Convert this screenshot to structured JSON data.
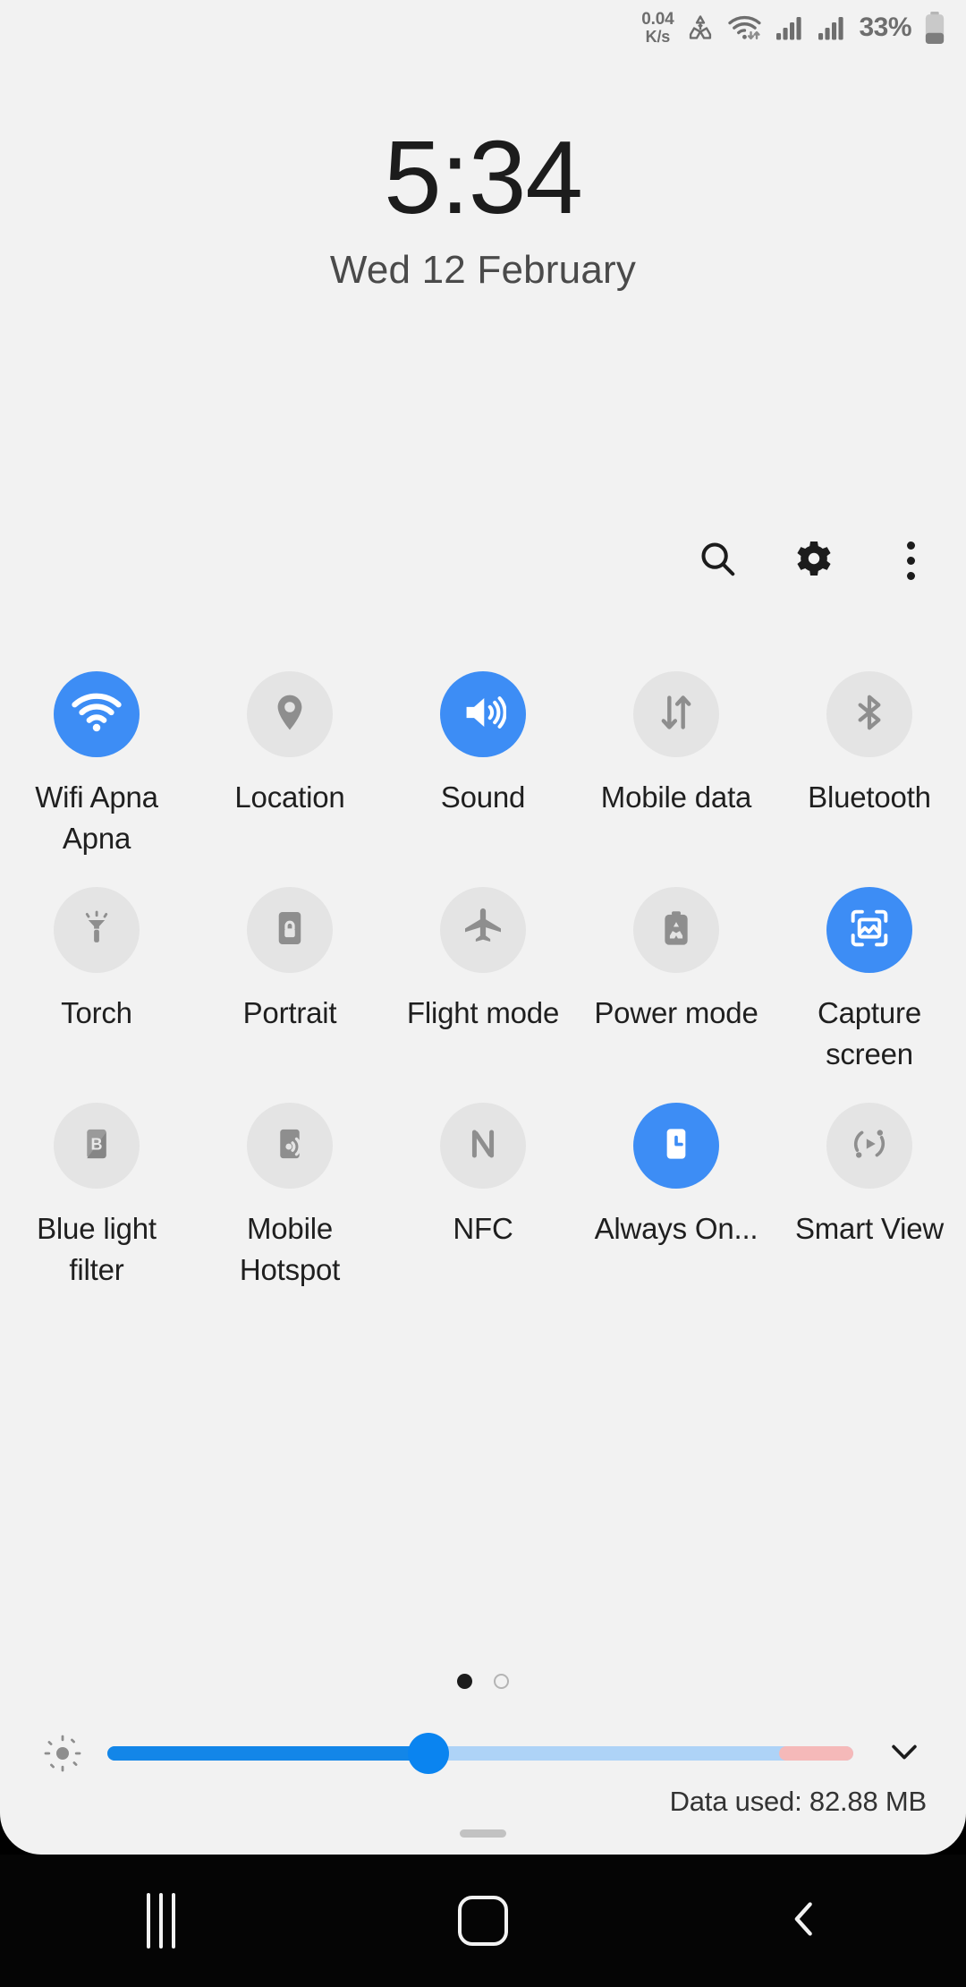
{
  "statusbar": {
    "net_rate_value": "0.04",
    "net_rate_unit": "K/s",
    "icons": [
      "data-saver-icon",
      "wifi-icon",
      "signal-sim1-icon",
      "signal-sim2-icon"
    ],
    "battery_percent": "33%",
    "battery_icon": "battery-icon"
  },
  "clock": {
    "time": "5:34",
    "date": "Wed 12 February"
  },
  "toolbar": {
    "search_icon": "search-icon",
    "settings_icon": "gear-icon",
    "more_icon": "more-vertical-icon"
  },
  "tiles": [
    {
      "label": "Wifi Apna Apna",
      "icon": "wifi-icon",
      "active": true
    },
    {
      "label": "Location",
      "icon": "location-pin-icon",
      "active": false
    },
    {
      "label": "Sound",
      "icon": "volume-on-icon",
      "active": true
    },
    {
      "label": "Mobile data",
      "icon": "mobile-data-icon",
      "active": false
    },
    {
      "label": "Bluetooth",
      "icon": "bluetooth-icon",
      "active": false
    },
    {
      "label": "Torch",
      "icon": "flashlight-icon",
      "active": false
    },
    {
      "label": "Portrait",
      "icon": "rotation-lock-icon",
      "active": false
    },
    {
      "label": "Flight mode",
      "icon": "airplane-icon",
      "active": false
    },
    {
      "label": "Power mode",
      "icon": "power-saving-icon",
      "active": false
    },
    {
      "label": "Capture screen",
      "icon": "screenshot-icon",
      "active": true
    },
    {
      "label": "Blue light filter",
      "icon": "blue-light-filter-icon",
      "active": false
    },
    {
      "label": "Mobile Hotspot",
      "icon": "hotspot-icon",
      "active": false
    },
    {
      "label": "NFC",
      "icon": "nfc-icon",
      "active": false
    },
    {
      "label": "Always On...",
      "icon": "always-on-display-icon",
      "active": true
    },
    {
      "label": "Smart View",
      "icon": "smart-view-icon",
      "active": false
    }
  ],
  "pagination": {
    "total": 2,
    "current": 1
  },
  "brightness": {
    "sun_icon": "brightness-icon",
    "value_percent": 43,
    "warm_zone_percent": 10,
    "expand_icon": "chevron-down-icon"
  },
  "footer": {
    "data_used": "Data used: 82.88 MB",
    "handle": "drag-handle"
  },
  "navbar": {
    "recents_icon": "recents-icon",
    "home_icon": "home-icon",
    "back_icon": "back-icon"
  },
  "colors": {
    "accent_blue": "#3d8df5",
    "slider_blue": "#1386e8",
    "panel_bg": "#f2f2f2",
    "tile_off": "#e4e4e4",
    "navbar_bg": "#050505"
  }
}
